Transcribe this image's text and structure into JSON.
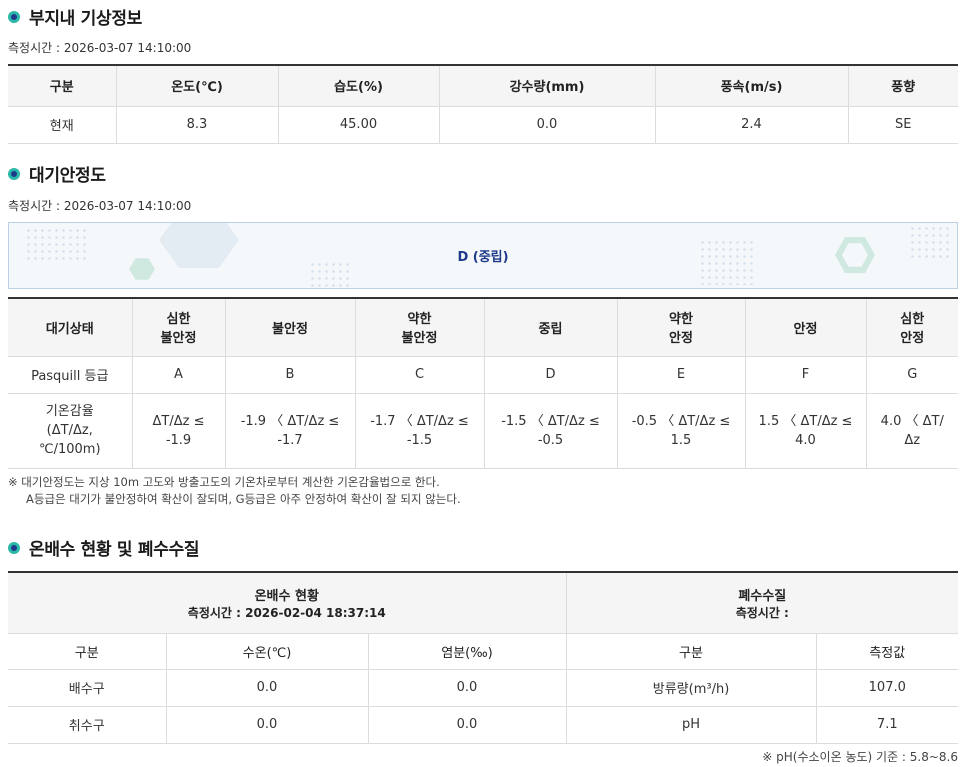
{
  "weather": {
    "title": "부지내 기상정보",
    "measured_time": "측정시간 : 2026-03-07 14:10:00",
    "headers": [
      "구분",
      "온도(℃)",
      "습도(%)",
      "강수량(mm)",
      "풍속(m/s)",
      "풍향"
    ],
    "row": [
      "현재",
      "8.3",
      "45.00",
      "0.0",
      "2.4",
      "SE"
    ]
  },
  "stability": {
    "title": "대기안정도",
    "measured_time": "측정시간 : 2026-03-07 14:10:00",
    "current": "D (중립)",
    "headers": [
      "대기상태",
      "심한\n불안정",
      "불안정",
      "약한\n불안정",
      "중립",
      "약한\n안정",
      "안정",
      "심한\n안정"
    ],
    "pasquill": [
      "Pasquill 등급",
      "A",
      "B",
      "C",
      "D",
      "E",
      "F",
      "G"
    ],
    "lapse": [
      "기온감율\n(ΔT/Δz,\n℃/100m)",
      "ΔT/Δz ≤\n-1.9",
      "-1.9 〈 ΔT/Δz ≤\n-1.7",
      "-1.7 〈 ΔT/Δz ≤\n-1.5",
      "-1.5 〈 ΔT/Δz ≤\n-0.5",
      "-0.5 〈 ΔT/Δz ≤\n1.5",
      "1.5 〈 ΔT/Δz ≤\n4.0",
      "4.0 〈 ΔT/\nΔz"
    ],
    "note_line1": "※ 대기안정도는 지상 10m 고도와 방출고도의 기온차로부터 계산한 기온감율법으로 한다.",
    "note_line2": "A등급은 대기가 불안정하여 확산이 잘되며, G등급은 아주 안정하여 확산이 잘 되지 않는다."
  },
  "discharge": {
    "title": "온배수 현황 및 폐수수질",
    "thermal_title": "온배수 현황",
    "thermal_time": "측정시간 : 2026-02-04 18:37:14",
    "waste_title": "폐수수질",
    "waste_time": "측정시간 :",
    "thermal_headers": [
      "구분",
      "수온(℃)",
      "염분(‰)"
    ],
    "waste_headers": [
      "구분",
      "측정값"
    ],
    "rows": [
      [
        "배수구",
        "0.0",
        "0.0",
        "방류량(m³/h)",
        "107.0"
      ],
      [
        "취수구",
        "0.0",
        "0.0",
        "pH",
        "7.1"
      ]
    ],
    "footnote": "※ pH(수소이온 농도) 기준 : 5.8~8.6"
  }
}
